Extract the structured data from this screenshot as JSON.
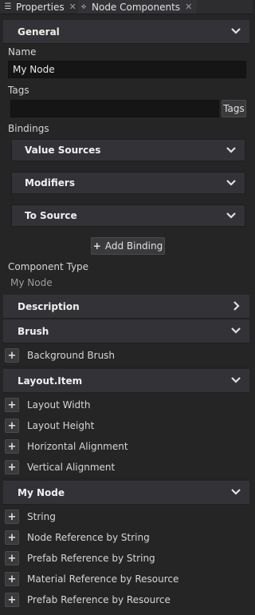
{
  "tabs": [
    {
      "icon": "properties-icon",
      "label": "Properties"
    },
    {
      "icon": "node-components-icon",
      "label": "Node Components"
    }
  ],
  "general": {
    "title": "General",
    "name_label": "Name",
    "name_value": "My Node",
    "tags_label": "Tags",
    "tags_value": "",
    "tags_button": "Tags",
    "bindings_label": "Bindings",
    "bindings": [
      "Value Sources",
      "Modifiers",
      "To Source"
    ],
    "add_binding": "Add Binding",
    "component_type_label": "Component Type",
    "component_type_value": "My Node"
  },
  "sections": {
    "description": "Description",
    "brush": "Brush",
    "brush_items": [
      "Background Brush"
    ],
    "layout_item": "Layout.Item",
    "layout_items": [
      "Layout Width",
      "Layout Height",
      "Horizontal Alignment",
      "Vertical Alignment"
    ],
    "my_node": "My Node",
    "my_node_items": [
      "String",
      "Node Reference by String",
      "Prefab Reference by String",
      "Material Reference by Resource",
      "Prefab Reference by Resource"
    ]
  },
  "colors": {
    "panel": "#252526",
    "header": "#333337",
    "input": "#151515",
    "text": "#d4d4d4"
  }
}
